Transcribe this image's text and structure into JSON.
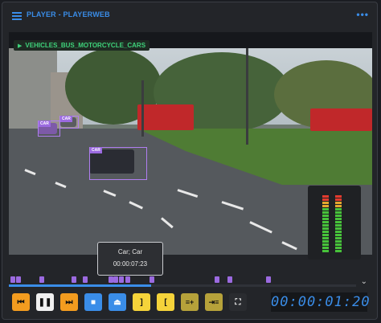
{
  "header": {
    "title": "PLAYER - PLAYERWEB",
    "menu_icon": "hamburger-icon",
    "more_icon": "more-dots-icon",
    "more_glyph": "•••"
  },
  "video": {
    "class_filter_label": "VEHICLES_BUS_MOTORCYCLE_CARS",
    "detections": [
      {
        "label": "CAR"
      },
      {
        "label": "CAR"
      },
      {
        "label": "CAR"
      }
    ]
  },
  "tooltip": {
    "title": "Car; Car",
    "time": "00:00:07:23"
  },
  "timeline": {
    "progress": 0.41,
    "expand_icon": "chevron-down-icon",
    "expand_glyph": "⌄"
  },
  "controls": {
    "buttons": [
      {
        "name": "skip-start-button",
        "icon": "skip-start-icon",
        "glyph": "⏮",
        "color": "#f39c1f"
      },
      {
        "name": "pause-button",
        "icon": "pause-icon",
        "glyph": "❚❚",
        "color": "#f0f0f0"
      },
      {
        "name": "skip-end-button",
        "icon": "skip-end-icon",
        "glyph": "⏭",
        "color": "#f39c1f"
      },
      {
        "name": "stop-button",
        "icon": "stop-icon",
        "glyph": "■",
        "color": "#3a8de8"
      },
      {
        "name": "eject-button",
        "icon": "eject-icon",
        "glyph": "⏏",
        "color": "#3a8de8"
      },
      {
        "name": "mark-out-button",
        "icon": "bracket-close-icon",
        "glyph": "]",
        "color": "#f5d33a"
      },
      {
        "name": "mark-in-button",
        "icon": "bracket-open-icon",
        "glyph": "[",
        "color": "#f5d33a"
      },
      {
        "name": "add-list-button",
        "icon": "playlist-add-icon",
        "glyph": "≡+",
        "color": "#b6a23a"
      },
      {
        "name": "indent-list-button",
        "icon": "list-indent-icon",
        "glyph": "⇥≡",
        "color": "#b6a23a"
      },
      {
        "name": "fullscreen-button",
        "icon": "fullscreen-icon",
        "glyph": "⛶",
        "color": "#2a2c30"
      }
    ],
    "timecode": "00:00:01:20"
  },
  "colors": {
    "accent": "#3a8de8",
    "detection": "#9b6ae0",
    "class_label": "#3ed27a"
  }
}
